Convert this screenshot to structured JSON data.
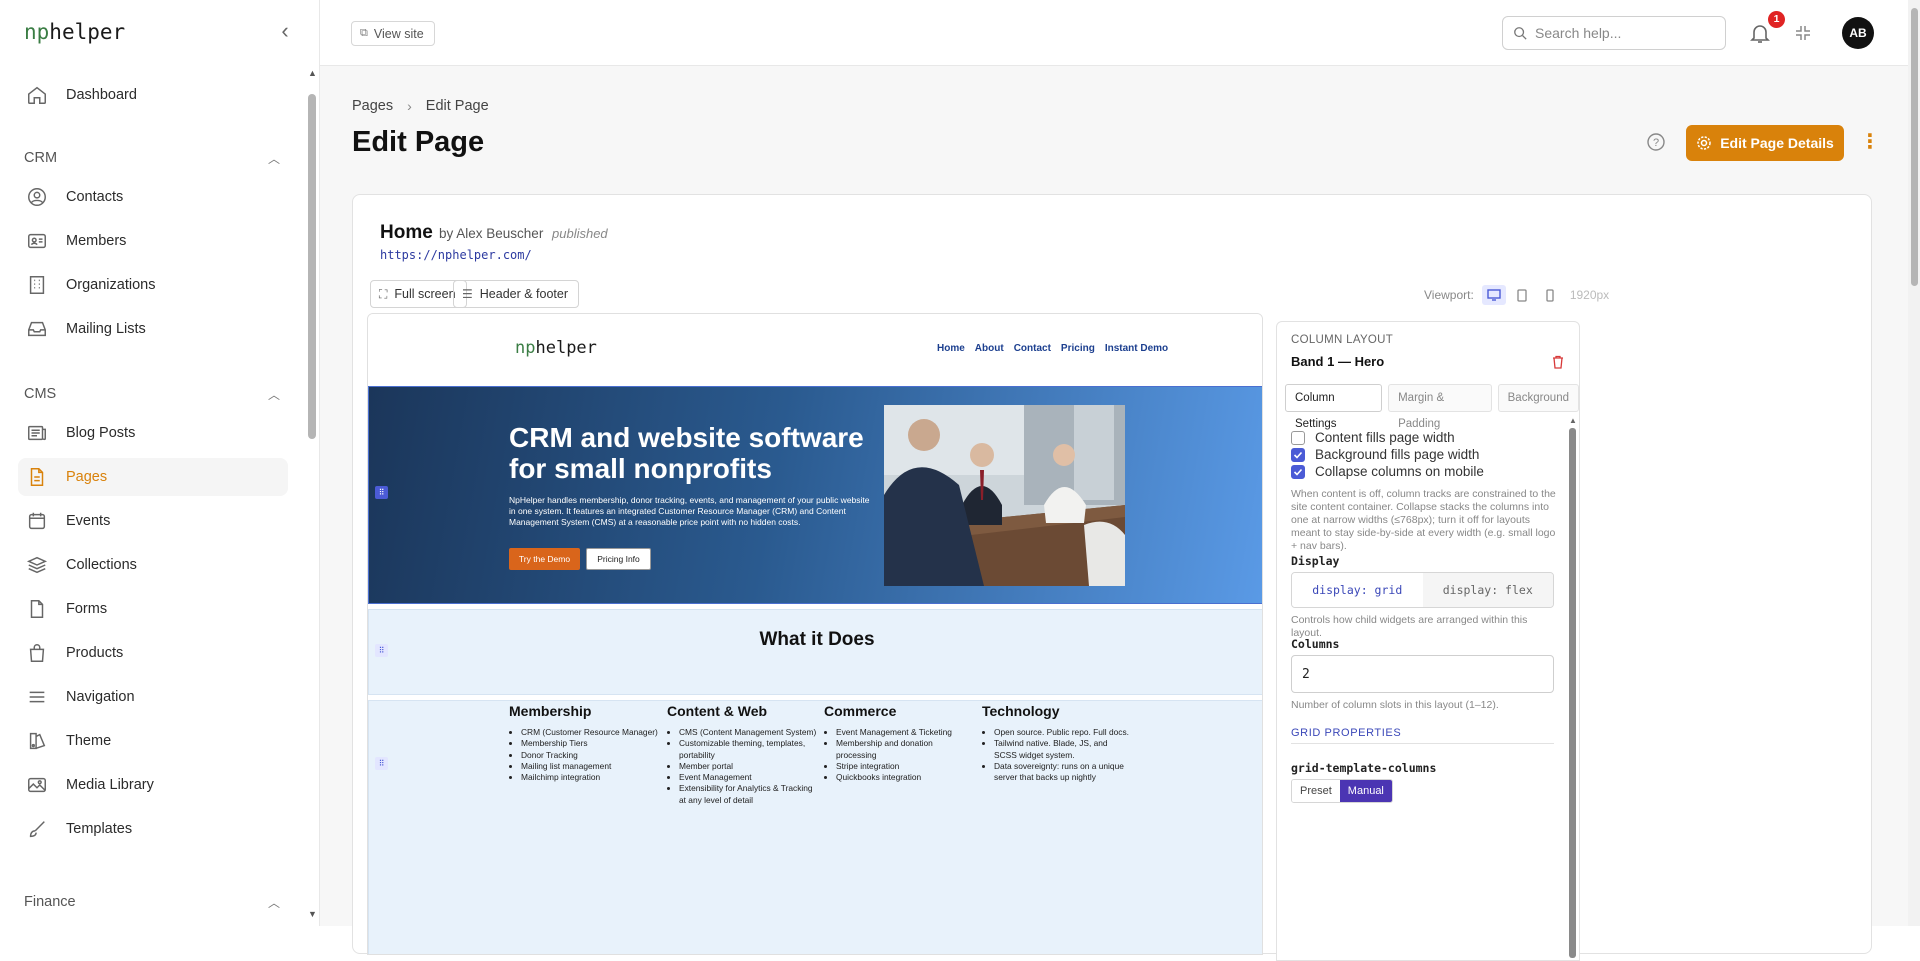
{
  "app": {
    "logo_prefix": "np",
    "logo_suffix": "helper"
  },
  "sidebar": {
    "top_items": [
      {
        "label": "Dashboard",
        "icon": "home-icon"
      }
    ],
    "sections": [
      {
        "label": "CRM",
        "expanded": true,
        "items": [
          {
            "label": "Contacts",
            "icon": "user-circle-icon"
          },
          {
            "label": "Members",
            "icon": "id-card-icon"
          },
          {
            "label": "Organizations",
            "icon": "building-icon"
          },
          {
            "label": "Mailing Lists",
            "icon": "inbox-icon"
          }
        ]
      },
      {
        "label": "CMS",
        "expanded": true,
        "items": [
          {
            "label": "Blog Posts",
            "icon": "newspaper-icon"
          },
          {
            "label": "Pages",
            "icon": "document-icon",
            "active": true
          },
          {
            "label": "Events",
            "icon": "calendar-icon"
          },
          {
            "label": "Collections",
            "icon": "stack-icon"
          },
          {
            "label": "Forms",
            "icon": "form-icon"
          },
          {
            "label": "Products",
            "icon": "shopping-bag-icon"
          },
          {
            "label": "Navigation",
            "icon": "menu-icon"
          },
          {
            "label": "Theme",
            "icon": "paint-icon"
          },
          {
            "label": "Media Library",
            "icon": "image-icon"
          },
          {
            "label": "Templates",
            "icon": "brush-icon"
          }
        ]
      },
      {
        "label": "Finance",
        "expanded": true,
        "items": []
      }
    ]
  },
  "topbar": {
    "view_site": "View site",
    "search_placeholder": "Search help...",
    "notification_count": "1",
    "avatar_initials": "AB"
  },
  "header": {
    "breadcrumb": [
      "Pages",
      "Edit Page"
    ],
    "title": "Edit Page",
    "edit_details_label": "Edit Page Details"
  },
  "page": {
    "name": "Home",
    "author": "by Alex Beuscher",
    "status": "published",
    "url": "https://nphelper.com/",
    "fullscreen_label": "Full screen",
    "header_footer_label": "Header & footer",
    "viewport_label": "Viewport:",
    "viewport_size": "1920px"
  },
  "preview": {
    "logo_prefix": "np",
    "logo_suffix": "helper",
    "nav_links": [
      "Home",
      "About",
      "Contact",
      "Pricing",
      "Instant Demo"
    ],
    "hero_title": "CRM and website software for small nonprofits",
    "hero_text": "NpHelper handles membership, donor tracking, events, and management of your public website in one system. It features an integrated Customer Resource Manager (CRM) and Content Management System (CMS) at a reasonable price point with no hidden costs.",
    "hero_btn_primary": "Try the Demo",
    "hero_btn_secondary": "Pricing Info",
    "what_title": "What it Does",
    "features": [
      {
        "title": "Membership",
        "items": [
          "CRM (Customer Resource Manager)",
          "Membership Tiers",
          "Donor Tracking",
          "Mailing list management",
          "Mailchimp integration"
        ]
      },
      {
        "title": "Content & Web",
        "items": [
          "CMS (Content Management System)",
          "Customizable theming, templates, portability",
          "Member portal",
          "Event Management",
          "Extensibility for Analytics & Tracking at any level of detail"
        ]
      },
      {
        "title": "Commerce",
        "items": [
          "Event Management & Ticketing",
          "Membership and donation processing",
          "Stripe integration",
          "Quickbooks integration"
        ]
      },
      {
        "title": "Technology",
        "items": [
          "Open source. Public repo. Full docs.",
          "Tailwind native. Blade, JS, and SCSS widget system.",
          "Data sovereignty: runs on a unique server that backs up nightly"
        ]
      }
    ]
  },
  "panel": {
    "kicker": "COLUMN LAYOUT",
    "title": "Band 1 — Hero",
    "tabs": [
      "Column Settings",
      "Margin & Padding",
      "Background"
    ],
    "checkboxes": [
      {
        "label": "Content fills page width",
        "checked": false
      },
      {
        "label": "Background fills page width",
        "checked": true
      },
      {
        "label": "Collapse columns on mobile",
        "checked": true
      }
    ],
    "checkbox_hint": "When content is off, column tracks are constrained to the site content container. Collapse stacks the columns into one at narrow widths (≤768px); turn it off for layouts meant to stay side-by-side at every width (e.g. small logo + nav bars).",
    "display_label": "Display",
    "display_options": [
      "display: grid",
      "display: flex"
    ],
    "display_selected": "display: grid",
    "display_hint": "Controls how child widgets are arranged within this layout.",
    "columns_label": "Columns",
    "columns_value": "2",
    "columns_hint": "Number of column slots in this layout (1–12).",
    "grid_props_title": "GRID PROPERTIES",
    "gtc_label": "grid-template-columns",
    "gtc_modes": [
      "Preset",
      "Manual"
    ],
    "gtc_selected": "Manual"
  },
  "colors": {
    "accent": "#d9820b",
    "indigo": "#4b5bd6",
    "badge": "#e02424"
  }
}
